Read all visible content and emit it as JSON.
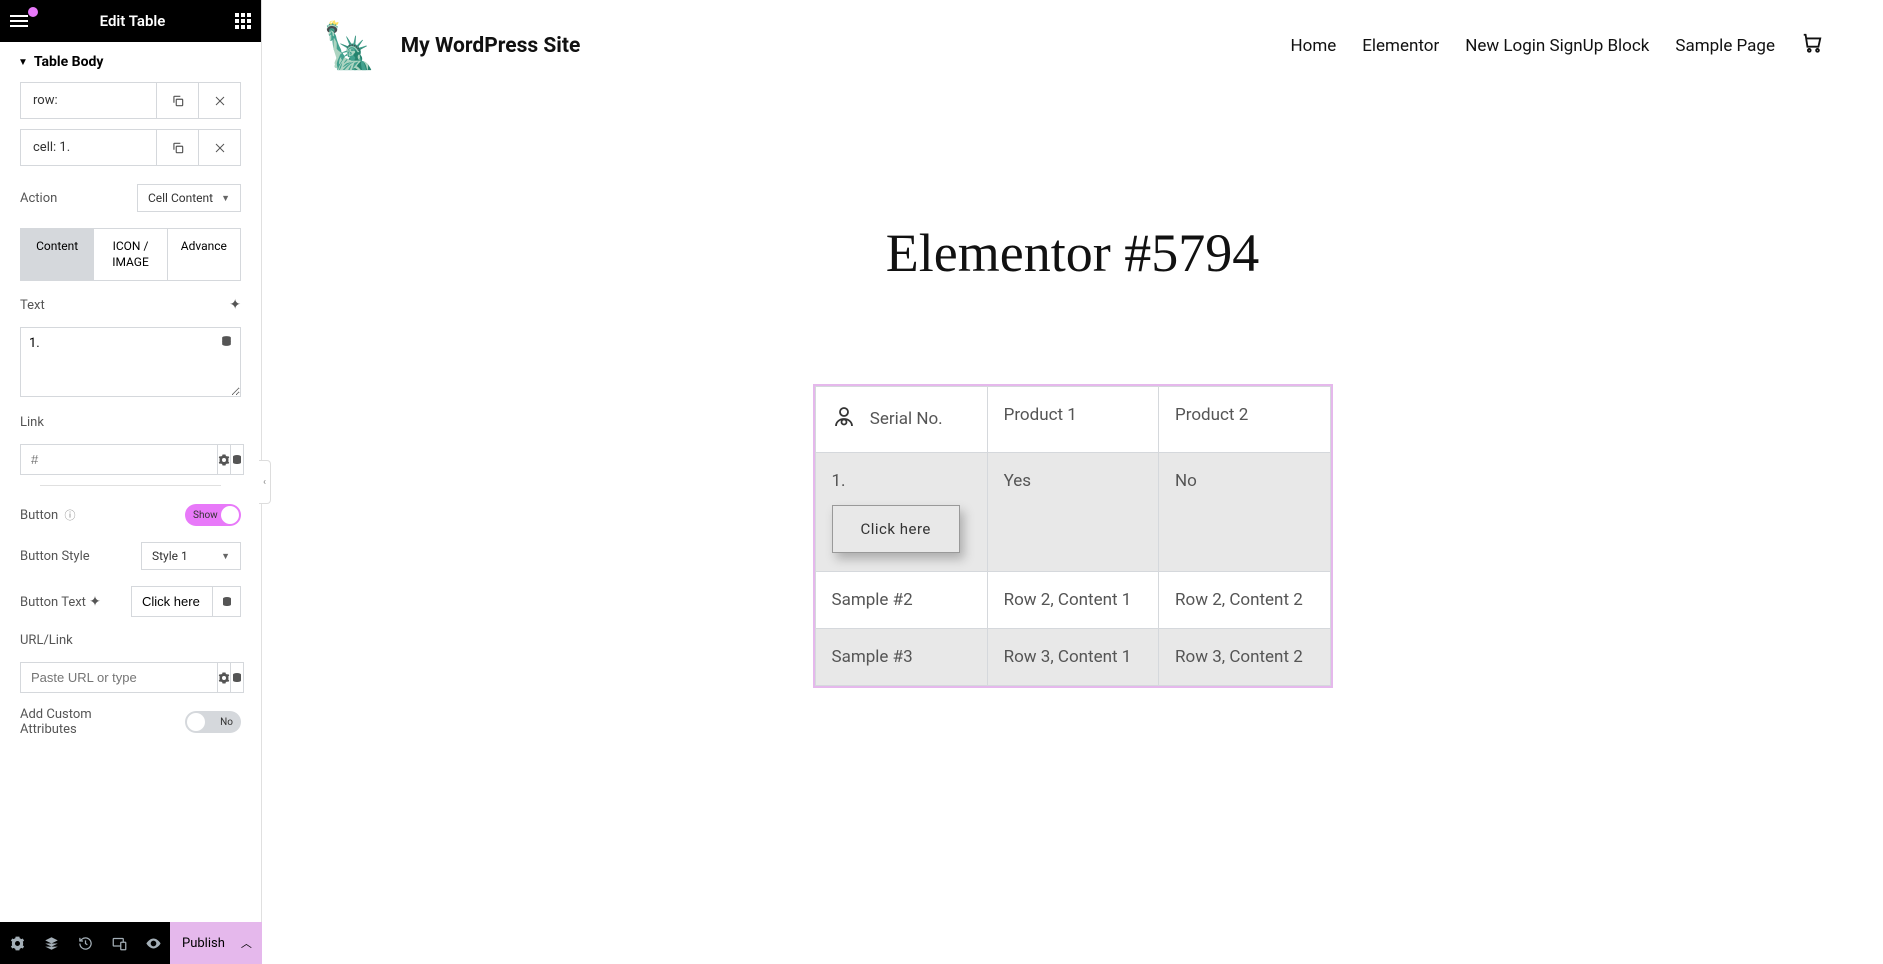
{
  "sidebar": {
    "title": "Edit Table",
    "section": "Table Body",
    "row_item": "row:",
    "cell_item": "cell: 1.",
    "action_label": "Action",
    "action_value": "Cell Content",
    "tabs": {
      "content": "Content",
      "icon": "ICON / IMAGE",
      "advance": "Advance"
    },
    "text_label": "Text",
    "text_value": "1.",
    "link_label": "Link",
    "link_placeholder": "#",
    "button_label": "Button",
    "button_toggle": "Show",
    "button_style_label": "Button Style",
    "button_style_value": "Style 1",
    "button_text_label": "Button Text",
    "button_text_value": "Click here",
    "url_link_label": "URL/Link",
    "url_placeholder": "Paste URL or type",
    "custom_attr_label": "Add Custom Attributes",
    "custom_attr_value": "No",
    "publish": "Publish"
  },
  "preview": {
    "site_title": "My WordPress Site",
    "nav": [
      "Home",
      "Elementor",
      "New Login SignUp Block",
      "Sample Page"
    ],
    "page_title": "Elementor #5794",
    "table": {
      "headers": [
        "Serial No.",
        "Product 1",
        "Product 2"
      ],
      "rows": [
        {
          "c1_text": "1.",
          "c1_button": "Click here",
          "c2": "Yes",
          "c3": "No"
        },
        {
          "c1_text": "Sample #2",
          "c2": "Row 2, Content 1",
          "c3": "Row 2, Content 2"
        },
        {
          "c1_text": "Sample #3",
          "c2": "Row 3, Content 1",
          "c3": "Row 3, Content 2"
        }
      ]
    }
  }
}
